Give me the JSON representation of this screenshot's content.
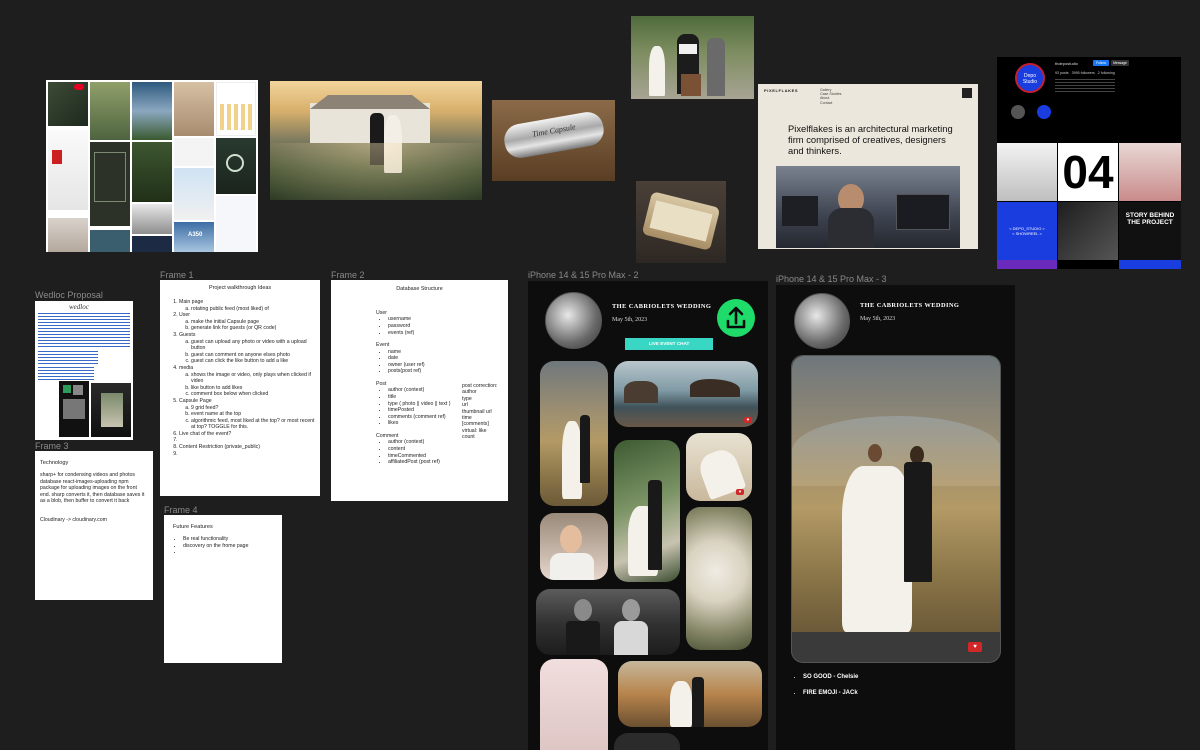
{
  "frames": {
    "wedloc_proposal": {
      "label": "Wedloc Proposal",
      "logo": "wedloc"
    },
    "frame1": {
      "label": "Frame 1",
      "title": "Project walkthrough Ideas",
      "items": [
        {
          "text": "Main page",
          "sub": [
            "rotating public feed (most liked) of"
          ]
        },
        {
          "text": "User",
          "sub": [
            "make the initial Capsule page",
            "generate link for guests (or QR code)"
          ]
        },
        {
          "text": "Guests",
          "sub": [
            "guest can upload any photo or video with a upload button",
            "guest can comment on anyone elses photo",
            "guest can click the like button to add a like"
          ]
        },
        {
          "text": "media",
          "sub": [
            "shows the image or video, only plays when clicked if video",
            "like button to add likes",
            "comment box below when clicked"
          ]
        },
        {
          "text": "Capsule Page",
          "sub": [
            "9 grid feed?",
            "event name at the top",
            "algorithmic feed, most liked at the top? or most recent at top? TOGGLE for this."
          ]
        },
        {
          "text": "Live chat of the event?",
          "sub": []
        },
        {
          "text": "",
          "sub": []
        },
        {
          "text": "Content Restriction (private_public)",
          "sub": []
        },
        {
          "text": "",
          "sub": []
        }
      ]
    },
    "frame2": {
      "label": "Frame 2",
      "title": "Database Structure",
      "groups": [
        {
          "name": "User",
          "fields": [
            "username",
            "password",
            "events (ref)"
          ]
        },
        {
          "name": "Event",
          "fields": [
            "name",
            "date",
            "owner (user ref)",
            "posts(post ref)"
          ]
        },
        {
          "name": "Post",
          "fields": [
            "author (context)",
            "title",
            "type ( photo || video || text )",
            "timePosted",
            "comments (comment ref)",
            "likes"
          ]
        },
        {
          "name": "Comment",
          "fields": [
            "author (context)",
            "content",
            "timeCommented",
            "affiliatedPost (post ref)"
          ]
        }
      ],
      "side_note": [
        "post correction:",
        "author",
        "type",
        "url",
        "thumbnail url",
        "time",
        "[comments]",
        "virtual: like",
        "count"
      ]
    },
    "frame3": {
      "label": "Frame 3",
      "heading": "Technology",
      "paragraph": "sharp+ for condensing videos and photos database react-images-uploading npm package for uploading images on the front end. sharp converts it, then database saves it as a blob, then buffer to convert it back",
      "footer": "Cloudinary -> cloudinary.com"
    },
    "frame4": {
      "label": "Frame 4",
      "heading": "Future Features",
      "items": [
        "Be real functionality",
        "discovery on the frome page",
        ""
      ]
    }
  },
  "phones": [
    {
      "label": "iPhone 14 & 15 Pro Max - 2",
      "wedding_title": "THE CABRIOLETS WEDDING",
      "date": "May 5th, 2023",
      "live_chat_button": "LIVE EVENT CHAT",
      "upload_icon": "upload-icon",
      "accent_color": "#1edb6a",
      "chat_button_color": "#3ad6c4"
    },
    {
      "label": "iPhone 14 & 15 Pro Max - 3",
      "wedding_title": "THE CABRIOLETS WEDDING",
      "date": "May 5th, 2023",
      "comments": [
        {
          "text": "SO GOOD - Chelsie"
        },
        {
          "text": "FIRE EMOJI - JACk"
        }
      ]
    }
  ],
  "moodboard": {
    "pixelflakes": {
      "brand": "PIXELFLAKES",
      "nav": [
        "Gallery",
        "Case Studies",
        "About",
        "Contact"
      ],
      "headline": "Pixelflakes is an architectural marketing firm comprised of creatives, designers and thinkers."
    },
    "depo": {
      "logo": "Depo Studio",
      "handle": "thdepostudio",
      "follow_label": "Follow",
      "message_label": "Message",
      "posts_stat": "93 posts",
      "followers_stat": "3995 followers",
      "following_stat": "2 following",
      "big_number": "04",
      "tagline_left": "< DEPO_STUDIO >",
      "tagline_left_sub": "< SHOWREEL >",
      "tagline_right": "STORY BEHIND THE PROJECT"
    },
    "capsule_label": "Time Capsule",
    "pinterest_label": "A350"
  }
}
